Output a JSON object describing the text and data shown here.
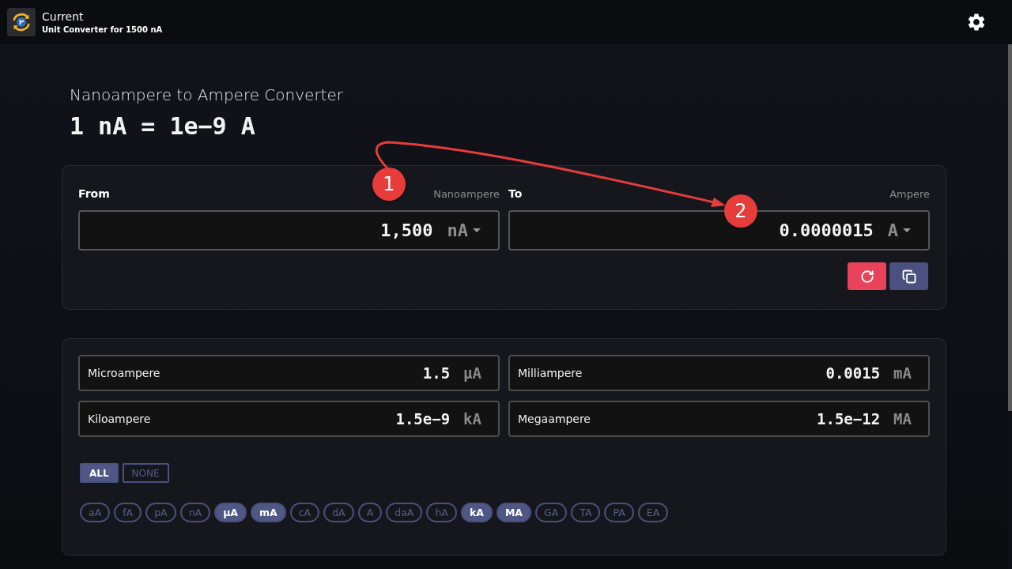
{
  "header": {
    "title": "Current",
    "subtitle": "Unit Converter for 1500 nA"
  },
  "converter": {
    "title": "Nanoampere to Ampere Converter",
    "formula": "1 nA = 1e−9 A",
    "from": {
      "label": "From",
      "unit_name": "Nanoampere",
      "value": "1,500",
      "unit": "nA"
    },
    "to": {
      "label": "To",
      "unit_name": "Ampere",
      "value": "0.0000015",
      "unit": "A"
    }
  },
  "results": [
    {
      "name": "Microampere",
      "value": "1.5",
      "unit": "µA"
    },
    {
      "name": "Milliampere",
      "value": "0.0015",
      "unit": "mA"
    },
    {
      "name": "Kiloampere",
      "value": "1.5e−9",
      "unit": "kA"
    },
    {
      "name": "Megaampere",
      "value": "1.5e−12",
      "unit": "MA"
    }
  ],
  "filter_buttons": [
    {
      "label": "ALL",
      "selected": true
    },
    {
      "label": "NONE",
      "selected": false
    }
  ],
  "unit_chips": [
    {
      "label": "aA",
      "selected": false
    },
    {
      "label": "fA",
      "selected": false
    },
    {
      "label": "pA",
      "selected": false
    },
    {
      "label": "nA",
      "selected": false
    },
    {
      "label": "µA",
      "selected": true
    },
    {
      "label": "mA",
      "selected": true
    },
    {
      "label": "cA",
      "selected": false
    },
    {
      "label": "dA",
      "selected": false
    },
    {
      "label": "A",
      "selected": false
    },
    {
      "label": "daA",
      "selected": false
    },
    {
      "label": "hA",
      "selected": false
    },
    {
      "label": "kA",
      "selected": true
    },
    {
      "label": "MA",
      "selected": true
    },
    {
      "label": "GA",
      "selected": false
    },
    {
      "label": "TA",
      "selected": false
    },
    {
      "label": "PA",
      "selected": false
    },
    {
      "label": "EA",
      "selected": false
    }
  ],
  "annotations": [
    {
      "label": "1"
    },
    {
      "label": "2"
    }
  ]
}
